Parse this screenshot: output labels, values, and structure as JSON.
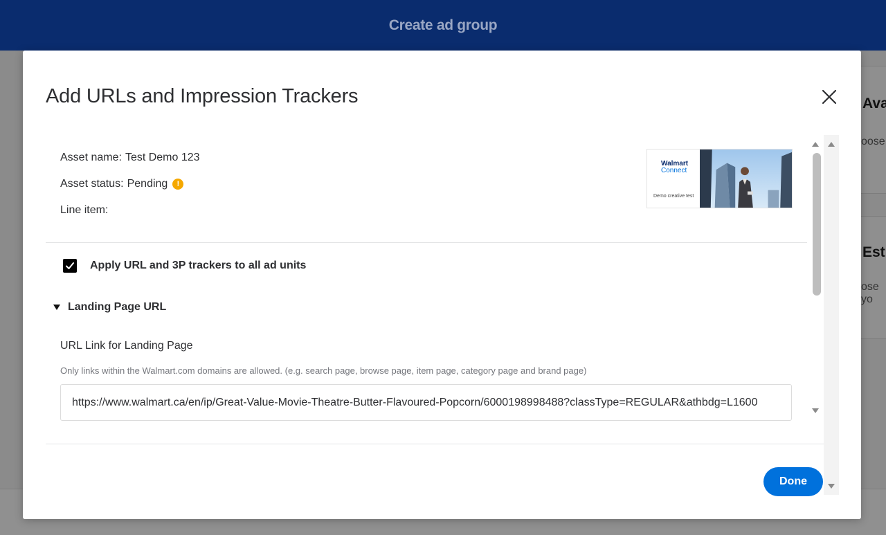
{
  "topbar": {
    "title": "Create ad group"
  },
  "background": {
    "heading_1": "Ava",
    "text_1": "oose",
    "heading_2": "Esti",
    "text_2": "ose yo"
  },
  "modal": {
    "title": "Add URLs and Impression Trackers",
    "asset_name_label": "Asset name:",
    "asset_name_value": "Test Demo 123",
    "asset_status_label": "Asset status:",
    "asset_status_value": "Pending",
    "status_icon_glyph": "!",
    "line_item_label": "Line item:",
    "line_item_value": "",
    "thumbnail": {
      "brand_line_1": "Walmart",
      "brand_line_2": "Connect",
      "caption": "Demo creative test"
    },
    "apply_all": {
      "label": "Apply URL and 3P trackers to all ad units",
      "checked": true
    },
    "landing_section": {
      "title": "Landing Page URL",
      "expanded": true,
      "field_label": "URL Link for Landing Page",
      "help_text": "Only links within the Walmart.com domains are allowed. (e.g. search page, browse page, item page, category page and brand page)",
      "url_value": "https://www.walmart.ca/en/ip/Great-Value-Movie-Theatre-Butter-Flavoured-Popcorn/6000198998488?classType=REGULAR&athbdg=L1600"
    },
    "done_label": "Done"
  },
  "colors": {
    "topbar": "#0a2c6e",
    "primary": "#0071dc",
    "warning": "#f5a800"
  }
}
